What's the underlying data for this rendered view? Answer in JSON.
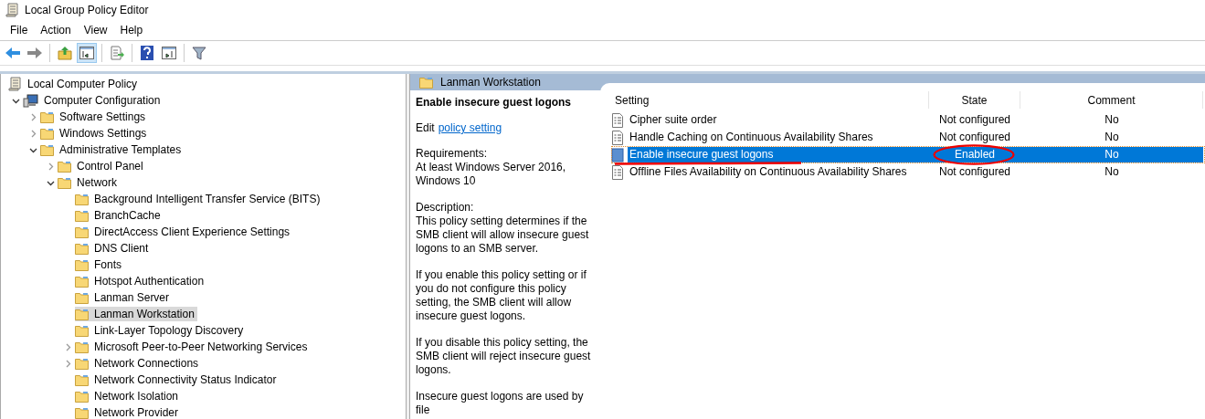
{
  "window": {
    "title": "Local Group Policy Editor"
  },
  "menu": [
    "File",
    "Action",
    "View",
    "Help"
  ],
  "toolbar": [
    {
      "kind": "back",
      "pressed": false
    },
    {
      "kind": "forward",
      "pressed": false
    },
    {
      "kind": "sep"
    },
    {
      "kind": "up",
      "pressed": false
    },
    {
      "kind": "tree",
      "pressed": true
    },
    {
      "kind": "sep"
    },
    {
      "kind": "export",
      "pressed": false
    },
    {
      "kind": "sep"
    },
    {
      "kind": "help",
      "pressed": false
    },
    {
      "kind": "pane",
      "pressed": false
    },
    {
      "kind": "sep"
    },
    {
      "kind": "filter",
      "pressed": false
    }
  ],
  "tree": [
    {
      "label": "Local Computer Policy",
      "selected": false,
      "children": [
        {
          "label": "Computer Configuration",
          "expanded": true,
          "selected": false,
          "children": [
            {
              "label": "Software Settings",
              "expanded": false,
              "selected": false
            },
            {
              "label": "Windows Settings",
              "expanded": false,
              "selected": false
            },
            {
              "label": "Administrative Templates",
              "expanded": true,
              "selected": false,
              "children": [
                {
                  "label": "Control Panel",
                  "expanded": false,
                  "selected": false
                },
                {
                  "label": "Network",
                  "expanded": true,
                  "selected": false,
                  "children": [
                    {
                      "label": "Background Intelligent Transfer Service (BITS)",
                      "selected": false
                    },
                    {
                      "label": "BranchCache",
                      "selected": false
                    },
                    {
                      "label": "DirectAccess Client Experience Settings",
                      "selected": false
                    },
                    {
                      "label": "DNS Client",
                      "selected": false
                    },
                    {
                      "label": "Fonts",
                      "selected": false
                    },
                    {
                      "label": "Hotspot Authentication",
                      "selected": false
                    },
                    {
                      "label": "Lanman Server",
                      "selected": false
                    },
                    {
                      "label": "Lanman Workstation",
                      "selected": true
                    },
                    {
                      "label": "Link-Layer Topology Discovery",
                      "selected": false
                    },
                    {
                      "label": "Microsoft Peer-to-Peer Networking Services",
                      "expanded": false,
                      "selected": false
                    },
                    {
                      "label": "Network Connections",
                      "expanded": false,
                      "selected": false
                    },
                    {
                      "label": "Network Connectivity Status Indicator",
                      "selected": false
                    },
                    {
                      "label": "Network Isolation",
                      "selected": false
                    },
                    {
                      "label": "Network Provider",
                      "selected": false
                    }
                  ]
                }
              ]
            }
          ]
        }
      ]
    }
  ],
  "details": {
    "header": "Lanman Workstation",
    "description": {
      "title": "Enable insecure guest logons",
      "edit_prefix": "Edit",
      "edit_link": "policy setting",
      "paragraphs": [
        "Requirements:\nAt least Windows Server 2016, Windows 10",
        "Description:\nThis policy setting determines if the SMB client will allow insecure guest logons to an SMB server.",
        "If you enable this policy setting or if you do not configure this policy setting, the SMB client will allow insecure guest logons.",
        "If you disable this policy setting, the SMB client will reject insecure guest logons.",
        "Insecure guest logons are used by file"
      ]
    },
    "columns": [
      "Setting",
      "State",
      "Comment"
    ],
    "rows": [
      {
        "setting": "Cipher suite order",
        "state": "Not configured",
        "comment": "No",
        "selected": false
      },
      {
        "setting": "Handle Caching on Continuous Availability Shares",
        "state": "Not configured",
        "comment": "No",
        "selected": false
      },
      {
        "setting": "Enable insecure guest logons",
        "state": "Enabled",
        "comment": "No",
        "selected": true,
        "hand_marked": true
      },
      {
        "setting": "Offline Files Availability on Continuous Availability Shares",
        "state": "Not configured",
        "comment": "No",
        "selected": false
      }
    ]
  }
}
